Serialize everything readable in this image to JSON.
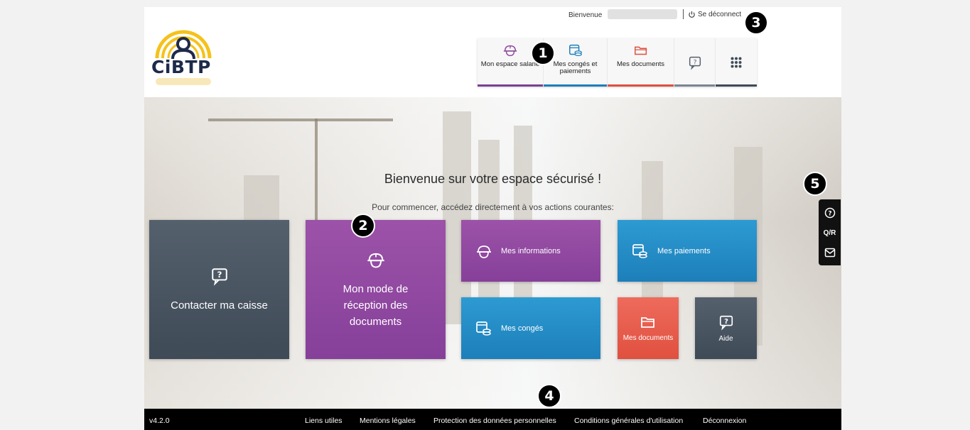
{
  "header": {
    "logo_text": "CiBTP",
    "welcome_label": "Bienvenue",
    "logout_label": "Se déconnect"
  },
  "nav": [
    {
      "label": "Mon espace salarié",
      "icon": "worker-helmet-icon",
      "bar_color": "#7b3f94"
    },
    {
      "label": "Mes congés et paiements",
      "icon": "calendar-coins-icon",
      "bar_color": "#1d7fba"
    },
    {
      "label": "Mes documents",
      "icon": "folder-icon",
      "bar_color": "#e0503f"
    },
    {
      "label": "",
      "icon": "help-bubble-icon",
      "bar_color": "#7a8591"
    },
    {
      "label": "",
      "icon": "apps-grid-icon",
      "bar_color": "#3f4a57"
    }
  ],
  "hero": {
    "title": "Bienvenue sur votre espace sécurisé !",
    "subtitle": "Pour commencer, accédez directement à vos actions courantes:"
  },
  "tiles": {
    "contact": "Contacter ma caisse",
    "reception": "Mon mode de réception des documents",
    "infos": "Mes informations",
    "paiements": "Mes paiements",
    "conges": "Mes congés",
    "documents": "Mes documents",
    "aide": "Aide"
  },
  "side_panel": {
    "qr_label": "Q/R"
  },
  "footer": {
    "version": "v4.2.0",
    "links": [
      "Liens utiles",
      "Mentions légales",
      "Protection des données personnelles",
      "Conditions générales d'utilisation",
      "Déconnexion"
    ]
  },
  "badges": [
    "1",
    "2",
    "3",
    "4",
    "5"
  ],
  "colors": {
    "purple": "#86409a",
    "blue": "#1d7fba",
    "coral": "#e0503f",
    "slate": "#3f4a57"
  }
}
